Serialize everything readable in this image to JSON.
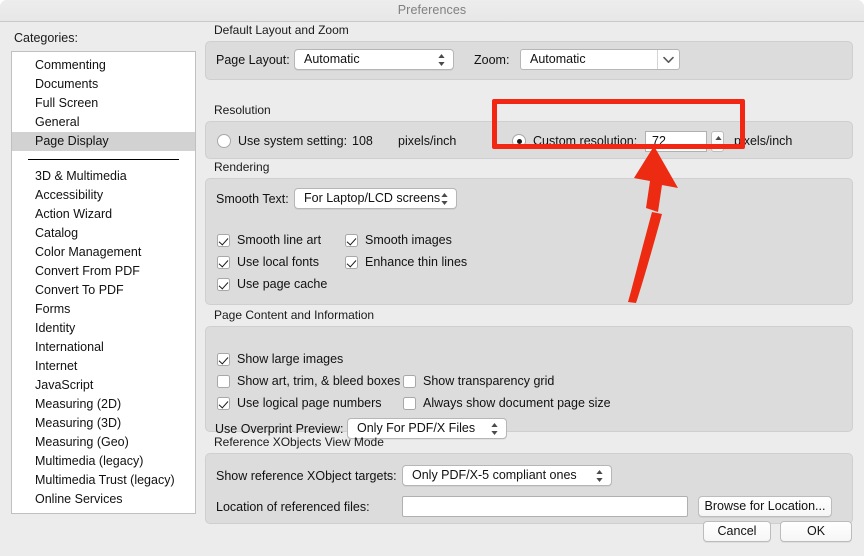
{
  "window": {
    "title": "Preferences"
  },
  "sidebar": {
    "heading": "Categories:",
    "selected": "Page Display",
    "group_top": [
      "Commenting",
      "Documents",
      "Full Screen",
      "General",
      "Page Display"
    ],
    "group_bottom": [
      "3D & Multimedia",
      "Accessibility",
      "Action Wizard",
      "Catalog",
      "Color Management",
      "Convert From PDF",
      "Convert To PDF",
      "Forms",
      "Identity",
      "International",
      "Internet",
      "JavaScript",
      "Measuring (2D)",
      "Measuring (3D)",
      "Measuring (Geo)",
      "Multimedia (legacy)",
      "Multimedia Trust (legacy)",
      "Online Services"
    ]
  },
  "default_layout": {
    "title": "Default Layout and Zoom",
    "page_layout_label": "Page Layout:",
    "page_layout_value": "Automatic",
    "zoom_label": "Zoom:",
    "zoom_value": "Automatic"
  },
  "resolution": {
    "title": "Resolution",
    "system_label": "Use system setting:",
    "system_value": "108",
    "system_unit": "pixels/inch",
    "system_selected": false,
    "custom_label": "Custom resolution:",
    "custom_value": "72",
    "custom_unit": "pixels/inch",
    "custom_selected": true
  },
  "rendering": {
    "title": "Rendering",
    "smooth_text_label": "Smooth Text:",
    "smooth_text_value": "For Laptop/LCD screens",
    "checkboxes": [
      {
        "label": "Smooth line art",
        "checked": true
      },
      {
        "label": "Smooth images",
        "checked": true
      },
      {
        "label": "Use local fonts",
        "checked": true
      },
      {
        "label": "Enhance thin lines",
        "checked": true
      },
      {
        "label": "Use page cache",
        "checked": true
      }
    ]
  },
  "page_content": {
    "title": "Page Content and Information",
    "checkboxes": [
      {
        "label": "Show large images",
        "checked": true
      },
      {
        "label": "Show art, trim, & bleed boxes",
        "checked": false
      },
      {
        "label": "Show transparency grid",
        "checked": false
      },
      {
        "label": "Use logical page numbers",
        "checked": true
      },
      {
        "label": "Always show document page size",
        "checked": false
      }
    ],
    "overprint_label": "Use Overprint Preview:",
    "overprint_value": "Only For PDF/X Files"
  },
  "reference_xobjects": {
    "title": "Reference XObjects View Mode",
    "targets_label": "Show reference XObject targets:",
    "targets_value": "Only PDF/X-5 compliant ones",
    "location_label": "Location of referenced files:",
    "location_value": "",
    "browse_label": "Browse for Location..."
  },
  "footer": {
    "cancel_label": "Cancel",
    "ok_label": "OK"
  },
  "annotation": {
    "color": "#f22613",
    "highlight_target": "Custom resolution field",
    "arrow_target": "Custom resolution field"
  }
}
